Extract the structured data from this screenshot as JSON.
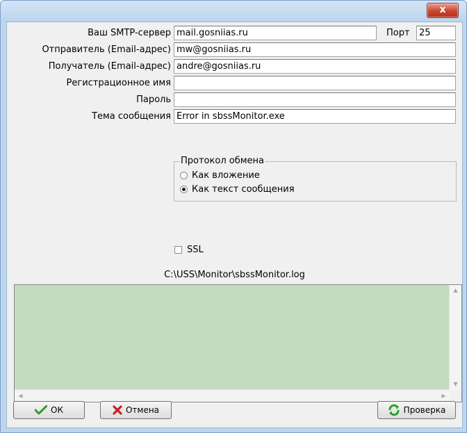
{
  "window": {
    "close_label": "x"
  },
  "form": {
    "smtp_label": "Ваш SMTP-сервер",
    "smtp_value": "mail.gosniias.ru",
    "port_label": "Порт",
    "port_value": "25",
    "sender_label": "Отправитель (Email-адрес)",
    "sender_value": "mw@gosniias.ru",
    "recipient_label": "Получатель (Email-адрес)",
    "recipient_value": "andre@gosniias.ru",
    "login_label": "Регистрационное имя",
    "login_value": "",
    "password_label": "Пароль",
    "password_value": "",
    "subject_label": "Тема сообщения",
    "subject_value": "Error in sbssMonitor.exe"
  },
  "protocol": {
    "title": "Протокол обмена",
    "options": [
      {
        "label": "Как вложение",
        "selected": false
      },
      {
        "label": "Как текст сообщения",
        "selected": true
      }
    ]
  },
  "ssl": {
    "label": "SSL",
    "checked": false
  },
  "log": {
    "path": "C:\\USS\\Monitor\\sbssMonitor.log",
    "content": ""
  },
  "buttons": {
    "ok": "ОК",
    "cancel": "Отмена",
    "check": "Проверка"
  },
  "colors": {
    "log_bg": "#c3dcbf",
    "ok_icon": "#2e9a2e",
    "cancel_icon": "#c62020",
    "check_icon": "#2aa02a"
  }
}
